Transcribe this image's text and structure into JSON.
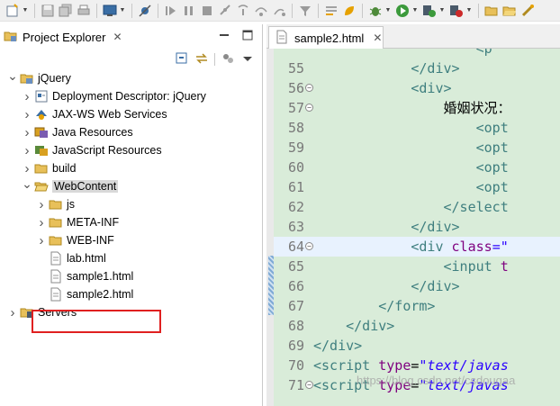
{
  "explorer": {
    "title": "Project Explorer",
    "close_glyph": "✕",
    "tree": [
      {
        "label": "jQuery",
        "icon": "project-icon",
        "twisty": "open",
        "depth": 0,
        "selected": false
      },
      {
        "label": "Deployment Descriptor: jQuery",
        "icon": "descriptor-icon",
        "twisty": "closed",
        "depth": 1,
        "selected": false
      },
      {
        "label": "JAX-WS Web Services",
        "icon": "webservice-icon",
        "twisty": "closed",
        "depth": 1,
        "selected": false
      },
      {
        "label": "Java Resources",
        "icon": "java-resources-icon",
        "twisty": "closed",
        "depth": 1,
        "selected": false
      },
      {
        "label": "JavaScript Resources",
        "icon": "js-resources-icon",
        "twisty": "closed",
        "depth": 1,
        "selected": false
      },
      {
        "label": "build",
        "icon": "folder-icon",
        "twisty": "closed",
        "depth": 1,
        "selected": false
      },
      {
        "label": "WebContent",
        "icon": "folder-open-icon",
        "twisty": "open",
        "depth": 1,
        "selected": true
      },
      {
        "label": "js",
        "icon": "folder-icon",
        "twisty": "closed",
        "depth": 2,
        "selected": false
      },
      {
        "label": "META-INF",
        "icon": "folder-icon",
        "twisty": "closed",
        "depth": 2,
        "selected": false
      },
      {
        "label": "WEB-INF",
        "icon": "folder-icon",
        "twisty": "closed",
        "depth": 2,
        "selected": false
      },
      {
        "label": "lab.html",
        "icon": "html-file-icon",
        "twisty": "none",
        "depth": 2,
        "selected": false
      },
      {
        "label": "sample1.html",
        "icon": "html-file-icon",
        "twisty": "none",
        "depth": 2,
        "selected": false
      },
      {
        "label": "sample2.html",
        "icon": "html-file-icon",
        "twisty": "none",
        "depth": 2,
        "selected": false
      },
      {
        "label": "Servers",
        "icon": "servers-icon",
        "twisty": "closed",
        "depth": 0,
        "selected": false
      }
    ]
  },
  "editor": {
    "tab_label": "sample2.html",
    "tab_close_glyph": "✕",
    "current_line": "64",
    "lines": [
      {
        "num": "",
        "fold": false,
        "parts": [
          {
            "t": "                    ",
            "c": "txt"
          },
          {
            "t": "<p",
            "c": "tag"
          }
        ]
      },
      {
        "num": "55",
        "fold": false,
        "parts": [
          {
            "t": "            ",
            "c": "txt"
          },
          {
            "t": "</div>",
            "c": "tag"
          }
        ]
      },
      {
        "num": "56",
        "fold": true,
        "parts": [
          {
            "t": "            ",
            "c": "txt"
          },
          {
            "t": "<div>",
            "c": "tag"
          }
        ]
      },
      {
        "num": "57",
        "fold": true,
        "parts": [
          {
            "t": "                婚姻状况：",
            "c": "txt"
          }
        ]
      },
      {
        "num": "58",
        "fold": false,
        "parts": [
          {
            "t": "                    ",
            "c": "txt"
          },
          {
            "t": "<opt",
            "c": "tag"
          }
        ]
      },
      {
        "num": "59",
        "fold": false,
        "parts": [
          {
            "t": "                    ",
            "c": "txt"
          },
          {
            "t": "<opt",
            "c": "tag"
          }
        ]
      },
      {
        "num": "60",
        "fold": false,
        "parts": [
          {
            "t": "                    ",
            "c": "txt"
          },
          {
            "t": "<opt",
            "c": "tag"
          }
        ]
      },
      {
        "num": "61",
        "fold": false,
        "parts": [
          {
            "t": "                    ",
            "c": "txt"
          },
          {
            "t": "<opt",
            "c": "tag"
          }
        ]
      },
      {
        "num": "62",
        "fold": false,
        "parts": [
          {
            "t": "                ",
            "c": "txt"
          },
          {
            "t": "</select",
            "c": "tag"
          }
        ]
      },
      {
        "num": "63",
        "fold": false,
        "parts": [
          {
            "t": "            ",
            "c": "txt"
          },
          {
            "t": "</div>",
            "c": "tag"
          }
        ]
      },
      {
        "num": "64",
        "fold": true,
        "parts": [
          {
            "t": "            ",
            "c": "txt"
          },
          {
            "t": "<div ",
            "c": "tag"
          },
          {
            "t": "class",
            "c": "attr"
          },
          {
            "t": "=\"",
            "c": "val"
          }
        ]
      },
      {
        "num": "65",
        "fold": false,
        "parts": [
          {
            "t": "                ",
            "c": "txt"
          },
          {
            "t": "<input ",
            "c": "tag"
          },
          {
            "t": "t",
            "c": "attr"
          }
        ]
      },
      {
        "num": "66",
        "fold": false,
        "parts": [
          {
            "t": "            ",
            "c": "txt"
          },
          {
            "t": "</div>",
            "c": "tag"
          }
        ]
      },
      {
        "num": "67",
        "fold": false,
        "parts": [
          {
            "t": "        ",
            "c": "txt"
          },
          {
            "t": "</form>",
            "c": "tag"
          }
        ]
      },
      {
        "num": "68",
        "fold": false,
        "parts": [
          {
            "t": "    ",
            "c": "txt"
          },
          {
            "t": "</div>",
            "c": "tag"
          }
        ]
      },
      {
        "num": "69",
        "fold": false,
        "parts": [
          {
            "t": "",
            "c": "txt"
          },
          {
            "t": "</div>",
            "c": "tag"
          }
        ]
      },
      {
        "num": "70",
        "fold": false,
        "parts": [
          {
            "t": "",
            "c": "txt"
          },
          {
            "t": "<script ",
            "c": "tag"
          },
          {
            "t": "type",
            "c": "attr"
          },
          {
            "t": "=",
            "c": "txt"
          },
          {
            "t": "\"text/javas",
            "c": "val"
          }
        ]
      },
      {
        "num": "71",
        "fold": true,
        "parts": [
          {
            "t": "",
            "c": "txt"
          },
          {
            "t": "<script ",
            "c": "tag"
          },
          {
            "t": "type",
            "c": "attr"
          },
          {
            "t": "=",
            "c": "txt"
          },
          {
            "t": "\"text/javas",
            "c": "val"
          }
        ]
      }
    ],
    "watermark": "https://blog.csdn.net/csdougaa"
  },
  "colors": {
    "editor_bg": "#d9ecd9",
    "current_line_bg": "#e8f2fe",
    "highlight_box": "#e02020",
    "tag": "#3f7f7f",
    "attr": "#7f007f",
    "value": "#2a00ff"
  }
}
